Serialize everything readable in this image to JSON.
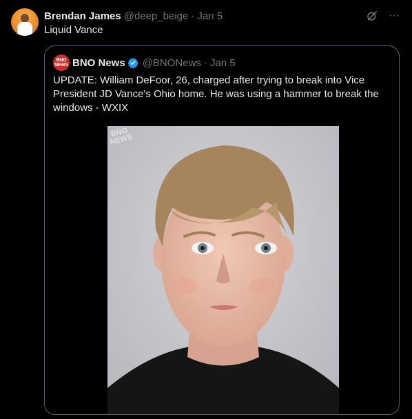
{
  "tweet": {
    "author_name": "Brendan James",
    "author_handle": "@deep_beige",
    "separator": "·",
    "date": "Jan 5",
    "text": "Liquid Vance",
    "avatar_icon": "person-avatar-icon",
    "grok_icon": "grok-icon",
    "more_icon": "more-icon",
    "more_glyph": "···"
  },
  "quote": {
    "author_name": "BNO News",
    "author_handle": "@BNONews",
    "separator": "·",
    "date": "Jan 5",
    "logo_text_top": "BNO",
    "logo_text_bottom": "NEWS",
    "verified_icon": "verified-badge-icon",
    "text": "UPDATE: William DeFoor, 26, charged after trying to break into Vice President JD Vance's Ohio home. He was using a hammer to break the windows - WXIX",
    "photo": {
      "watermark_top": "BNO",
      "watermark_bottom": "NEWS"
    }
  },
  "colors": {
    "background": "#000000",
    "text_primary": "#e7e9ea",
    "text_secondary": "#71767b",
    "border": "#536471",
    "verified": "#1d9bf0",
    "bno_red": "#d42b2b"
  }
}
